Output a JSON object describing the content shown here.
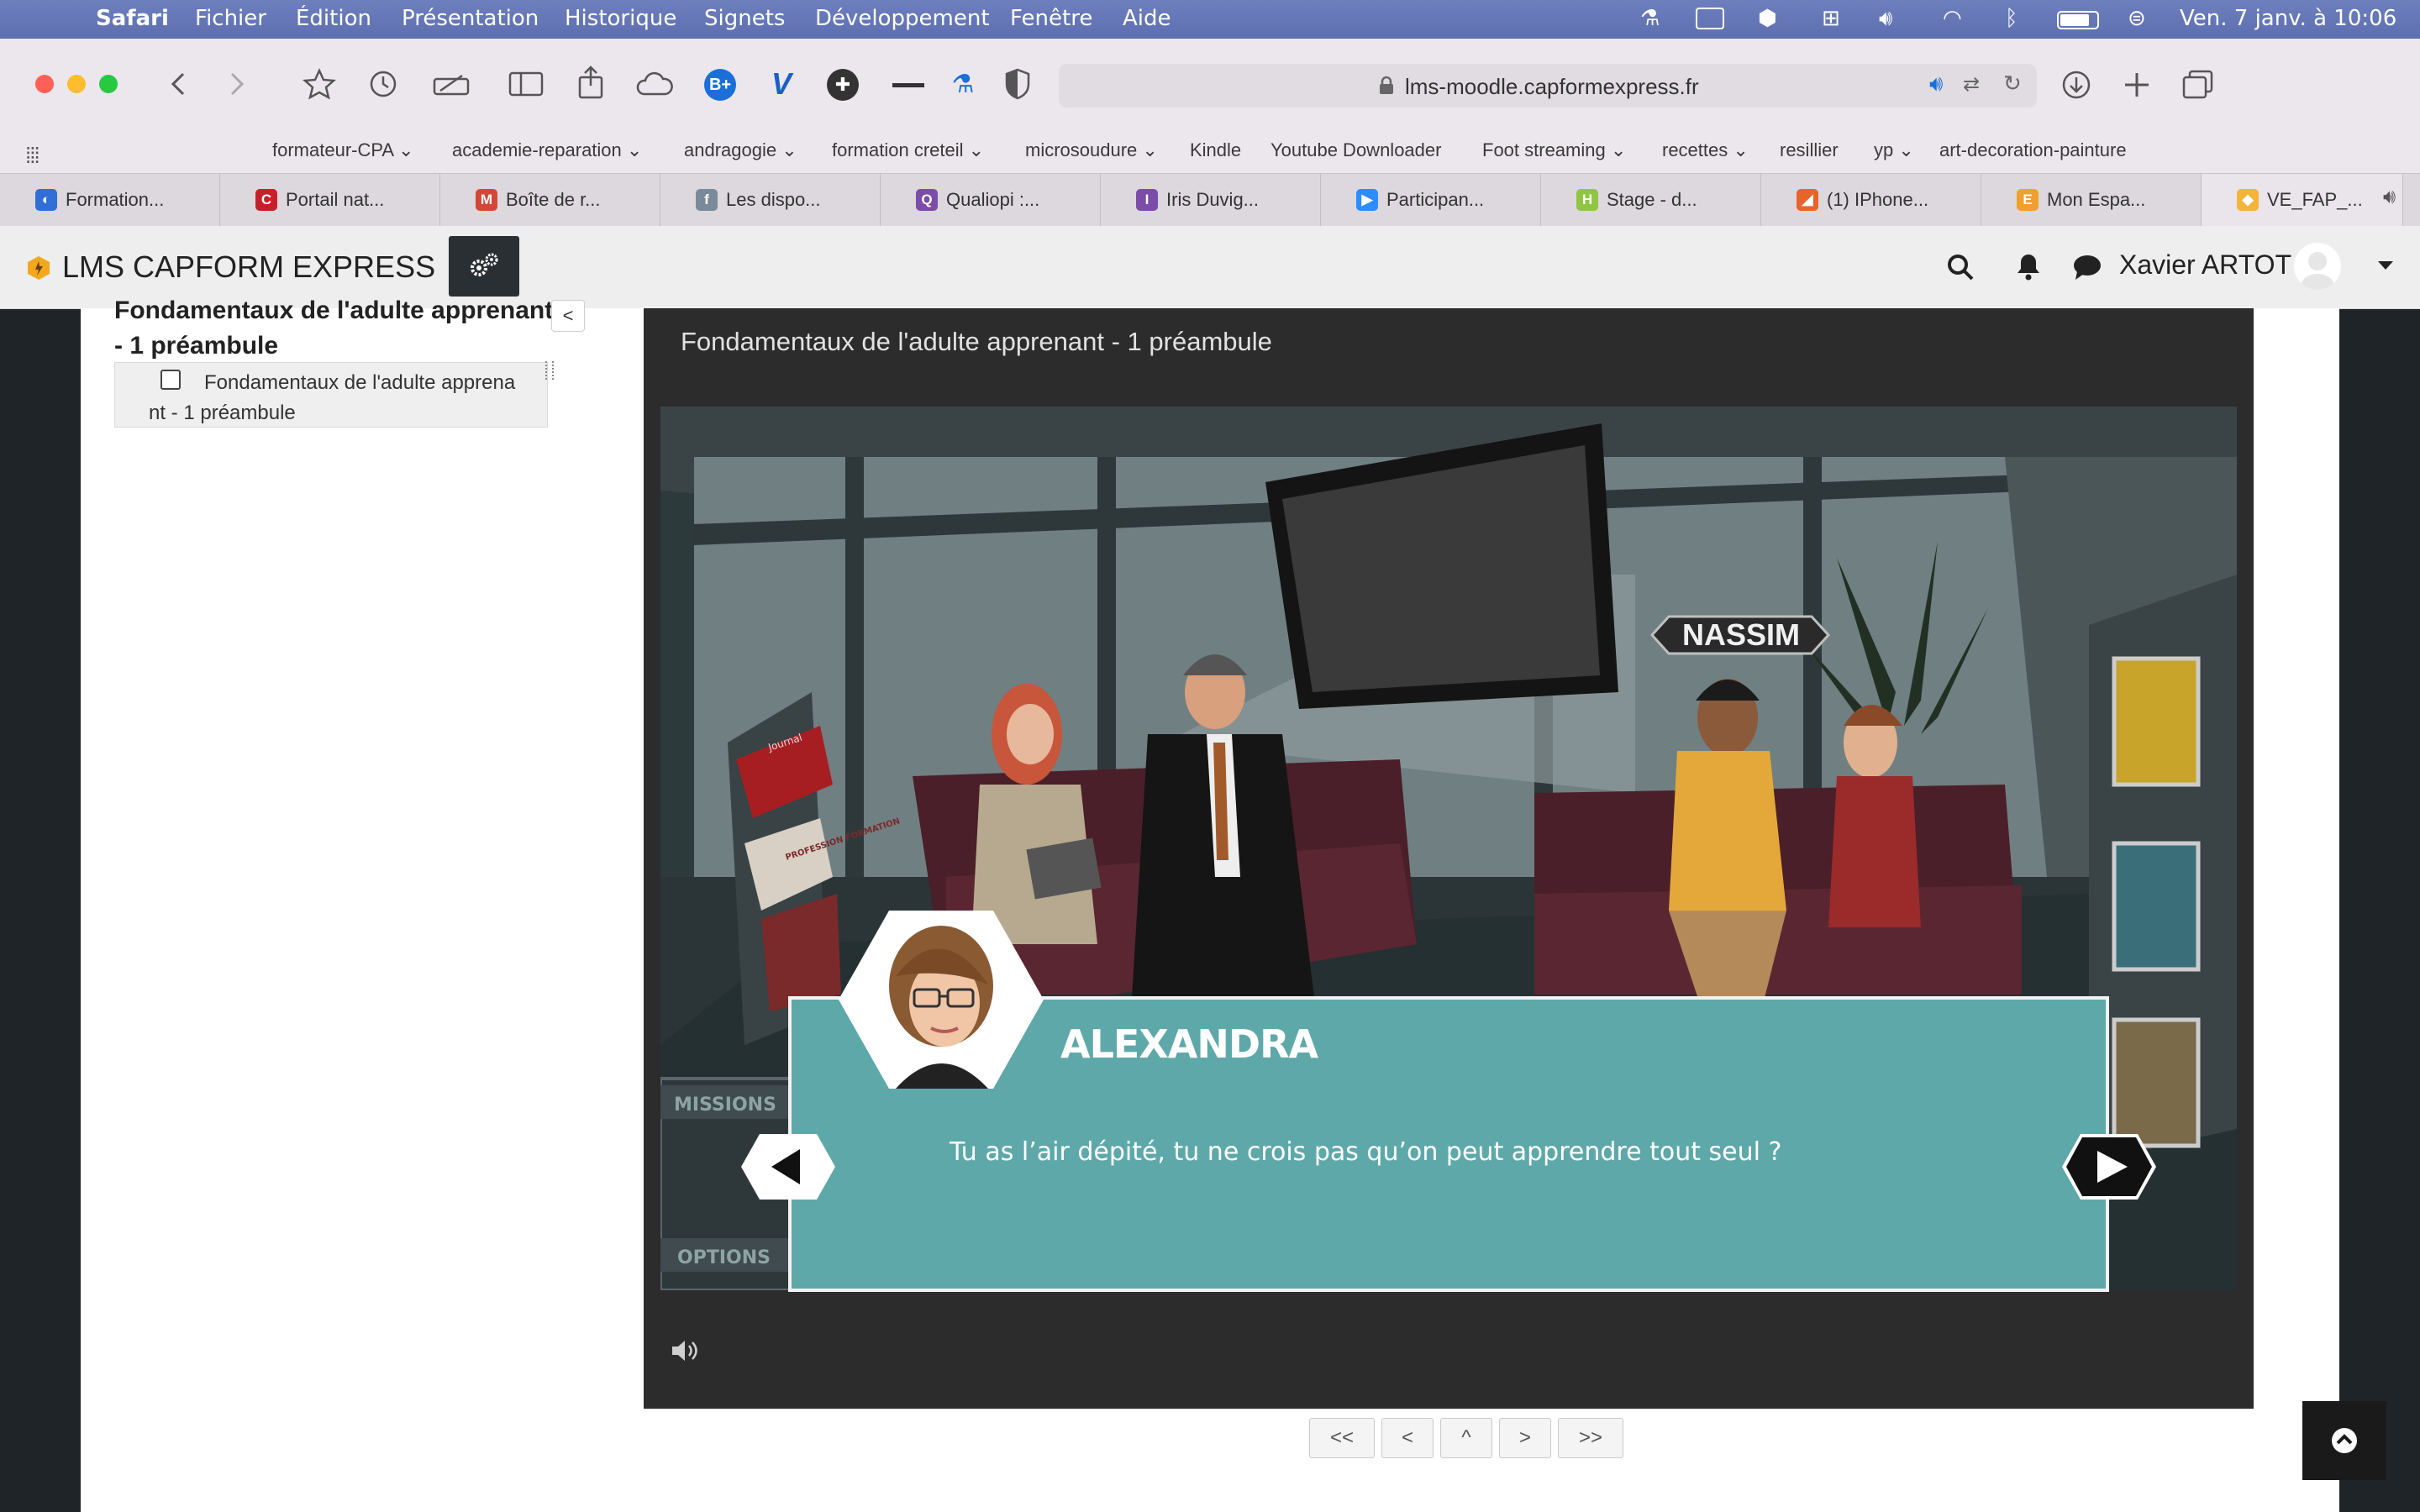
{
  "menubar": {
    "app": "Safari",
    "items": [
      "Fichier",
      "Édition",
      "Présentation",
      "Historique",
      "Signets",
      "Développement",
      "Fenêtre",
      "Aide"
    ],
    "datetime": "Ven. 7 janv. à  10:06"
  },
  "browser": {
    "url": "lms-moodle.capformexpress.fr",
    "bookmarks": [
      "formateur-CPA",
      "academie-reparation",
      "andragogie",
      "formation creteil",
      "microsoudure",
      "Kindle",
      "Youtube Downloader",
      "Foot streaming",
      "recettes",
      "resillier",
      "yp",
      "art-decoration-painture"
    ],
    "tabs": [
      {
        "label": "Formation...",
        "color": "#2f6fd6",
        "glyph": "◐"
      },
      {
        "label": "Portail nat...",
        "color": "#c8202a",
        "glyph": "C"
      },
      {
        "label": "Boîte de r...",
        "color": "#d44638",
        "glyph": "M"
      },
      {
        "label": "Les dispo...",
        "color": "#7a8a9a",
        "glyph": "f"
      },
      {
        "label": "Qualiopi :...",
        "color": "#7b4ca8",
        "glyph": "Q"
      },
      {
        "label": "Iris Duvig...",
        "color": "#7b4ca8",
        "glyph": "I"
      },
      {
        "label": "Participan...",
        "color": "#2d8cff",
        "glyph": "▶"
      },
      {
        "label": "Stage - d...",
        "color": "#8fc641",
        "glyph": "H"
      },
      {
        "label": "(1) IPhone...",
        "color": "#e8642a",
        "glyph": "◢"
      },
      {
        "label": "Mon Espa...",
        "color": "#f0a030",
        "glyph": "E"
      },
      {
        "label": "VE_FAP_...",
        "color": "#f4b43a",
        "glyph": "◆"
      }
    ]
  },
  "moodle": {
    "site_name": "LMS CAPFORM EXPRESS",
    "user_name": "Xavier ARTOT"
  },
  "sidebar": {
    "heading_line1": "Fondamentaux de l'adulte apprenant",
    "heading_line2": "- 1 préambule",
    "collapse_label": "<",
    "item_line1": "Fondamentaux de l'adulte apprena",
    "item_line2": "nt - 1 préambule"
  },
  "player": {
    "title": "Fondamentaux de l'adulte apprenant - 1 préambule",
    "nameplate": "NASSIM",
    "speaker": "ALEXANDRA",
    "dialogue": "Tu as l’air dépité, tu ne crois pas qu’on peut apprendre tout seul ?",
    "side_missions": "MISSIONS",
    "side_options": "OPTIONS",
    "poster_text_1": "Journal",
    "poster_text_2": "PROFESSION FORMATION"
  },
  "pager": {
    "first": "<<",
    "prev": "<",
    "up": "^",
    "next": ">",
    "last": ">>"
  },
  "colors": {
    "dialog_teal": "#5fa8aa",
    "navbar_bg": "#eeeeee",
    "settings_btn": "#2a2f33"
  }
}
